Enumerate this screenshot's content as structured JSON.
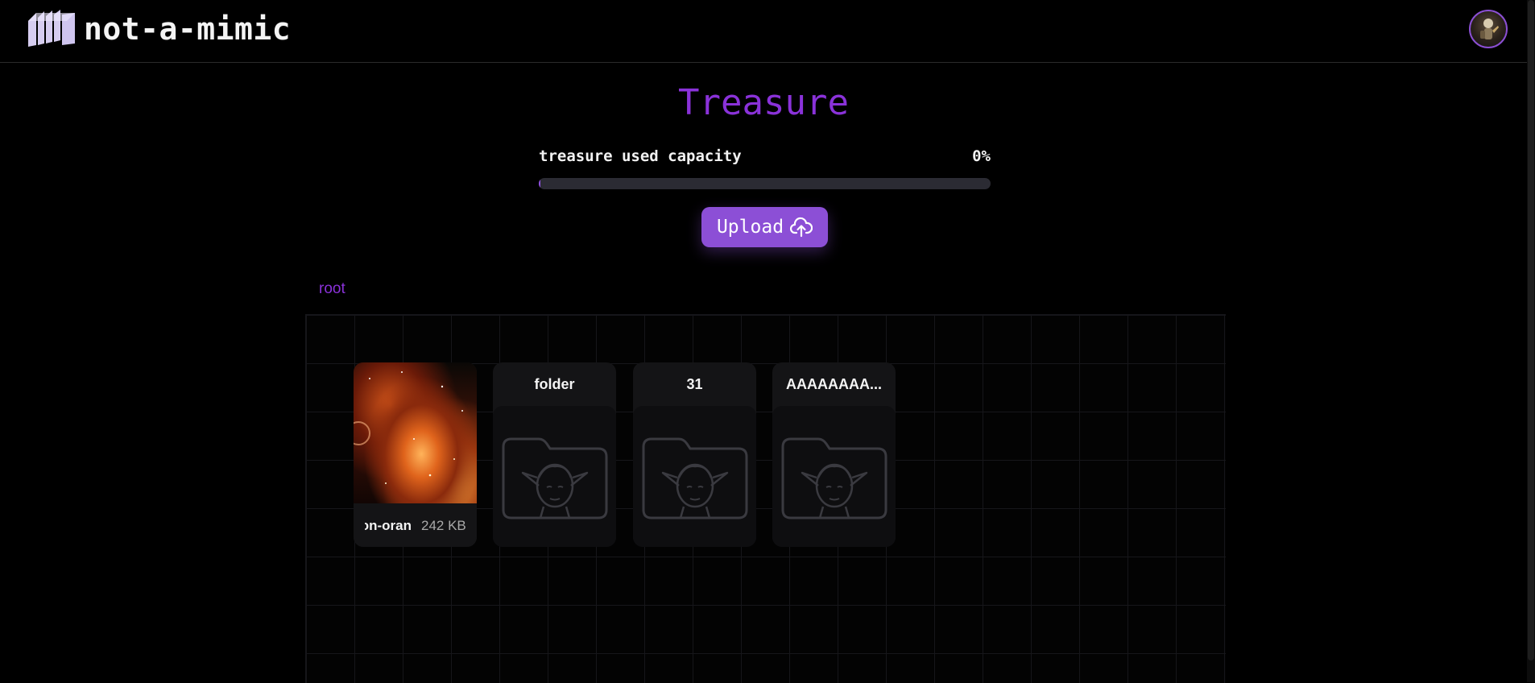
{
  "header": {
    "app_title": "not-a-mimic",
    "logo_icon": "chest-logo-icon",
    "avatar_icon": "user-avatar"
  },
  "main": {
    "page_title": "Treasure",
    "capacity": {
      "label": "treasure used capacity",
      "value_text": "0%",
      "fraction": 0.0
    },
    "upload_button": {
      "label": "Upload",
      "icon": "cloud-upload-icon"
    },
    "breadcrumb": [
      "root"
    ]
  },
  "items": [
    {
      "type": "file",
      "name": "on-oran",
      "size": "242 KB",
      "icon": "image-thumbnail"
    },
    {
      "type": "folder",
      "name": "folder",
      "icon": "elf-folder-icon"
    },
    {
      "type": "folder",
      "name": "31",
      "icon": "elf-folder-icon"
    },
    {
      "type": "folder",
      "name": "AAAAAAAA...",
      "icon": "elf-folder-icon"
    }
  ],
  "colors": {
    "accent": "#8a32d9",
    "button": "#8c4fd6",
    "background": "#000000",
    "card": "#141416"
  }
}
